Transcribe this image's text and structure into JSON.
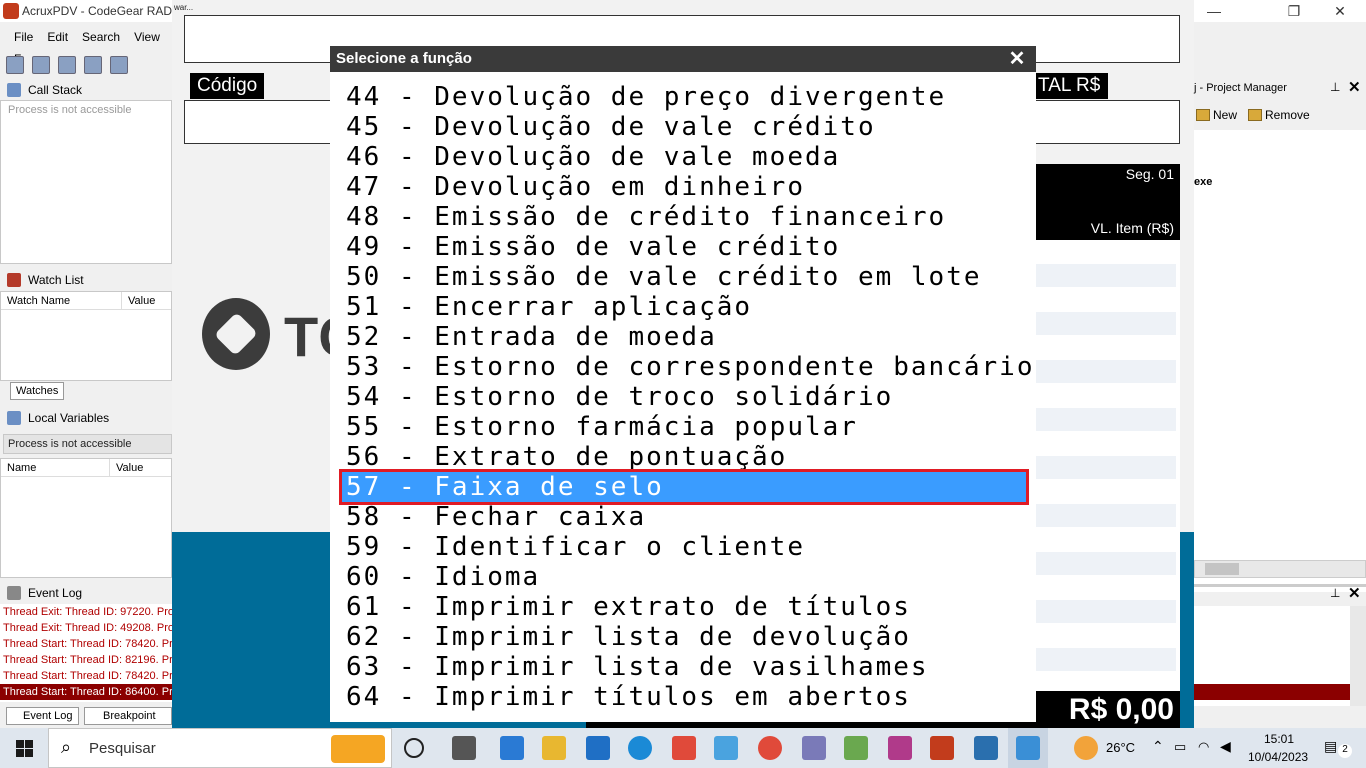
{
  "ide": {
    "title": "AcruxPDV - CodeGear RAD",
    "menu": [
      "File",
      "Edit",
      "Search",
      "View",
      "F"
    ],
    "call_stack": {
      "title": "Call Stack",
      "status": "Process is not accessible"
    },
    "watch_list": {
      "title": "Watch List",
      "col_name": "Watch Name",
      "col_value": "Value",
      "tab": "Watches"
    },
    "local_vars": {
      "title": "Local Variables",
      "status": "Process is not accessible",
      "col_name": "Name",
      "col_value": "Value"
    },
    "event_log": {
      "title": "Event Log",
      "lines": [
        "Thread Exit: Thread ID: 97220. Pro",
        "Thread Exit: Thread ID: 49208. Pro",
        "Thread Start: Thread ID: 78420. Pr",
        "Thread Start: Thread ID: 82196. Pr",
        "Thread Start: Thread ID: 78420. Pr",
        "Thread Start: Thread ID: 86400. Pr"
      ],
      "tabs": [
        "Event Log",
        "Breakpoint List"
      ]
    },
    "project_manager": {
      "title": "j - Project Manager",
      "new_label": "New",
      "remove_label": "Remove",
      "exe_label": "exe"
    }
  },
  "pdv": {
    "top_small_text": "war...",
    "codigo_label": "Código",
    "total_label": "TAL R$",
    "totvs_text": "TC",
    "seg_label": "Seg. 01",
    "vlitem_label": "VL. Item (R$)",
    "total_value": "R$ 0,00"
  },
  "modal": {
    "title": "Selecione a função",
    "close_label": "✕",
    "selected_index": 13,
    "functions": [
      "44 - Devolução de preço divergente",
      "45 - Devolução de vale crédito",
      "46 - Devolução de vale moeda",
      "47 - Devolução em dinheiro",
      "48 - Emissão de crédito financeiro",
      "49 - Emissão de vale crédito",
      "50 - Emissão de vale crédito em lote",
      "51 - Encerrar aplicação",
      "52 - Entrada de moeda",
      "53 - Estorno de correspondente bancário",
      "54 - Estorno de troco solidário",
      "55 - Estorno farmácia popular",
      "56 - Extrato de pontuação",
      "57 - Faixa de selo",
      "58 - Fechar caixa",
      "59 - Identificar o cliente",
      "60 - Idioma",
      "61 - Imprimir extrato de títulos",
      "62 - Imprimir lista de devolução",
      "63 - Imprimir lista de vasilhames",
      "64 - Imprimir títulos em abertos"
    ]
  },
  "taskbar": {
    "search_placeholder": "Pesquisar",
    "temperature": "26°C",
    "time": "15:01",
    "date": "10/04/2023",
    "notifications": "2"
  }
}
